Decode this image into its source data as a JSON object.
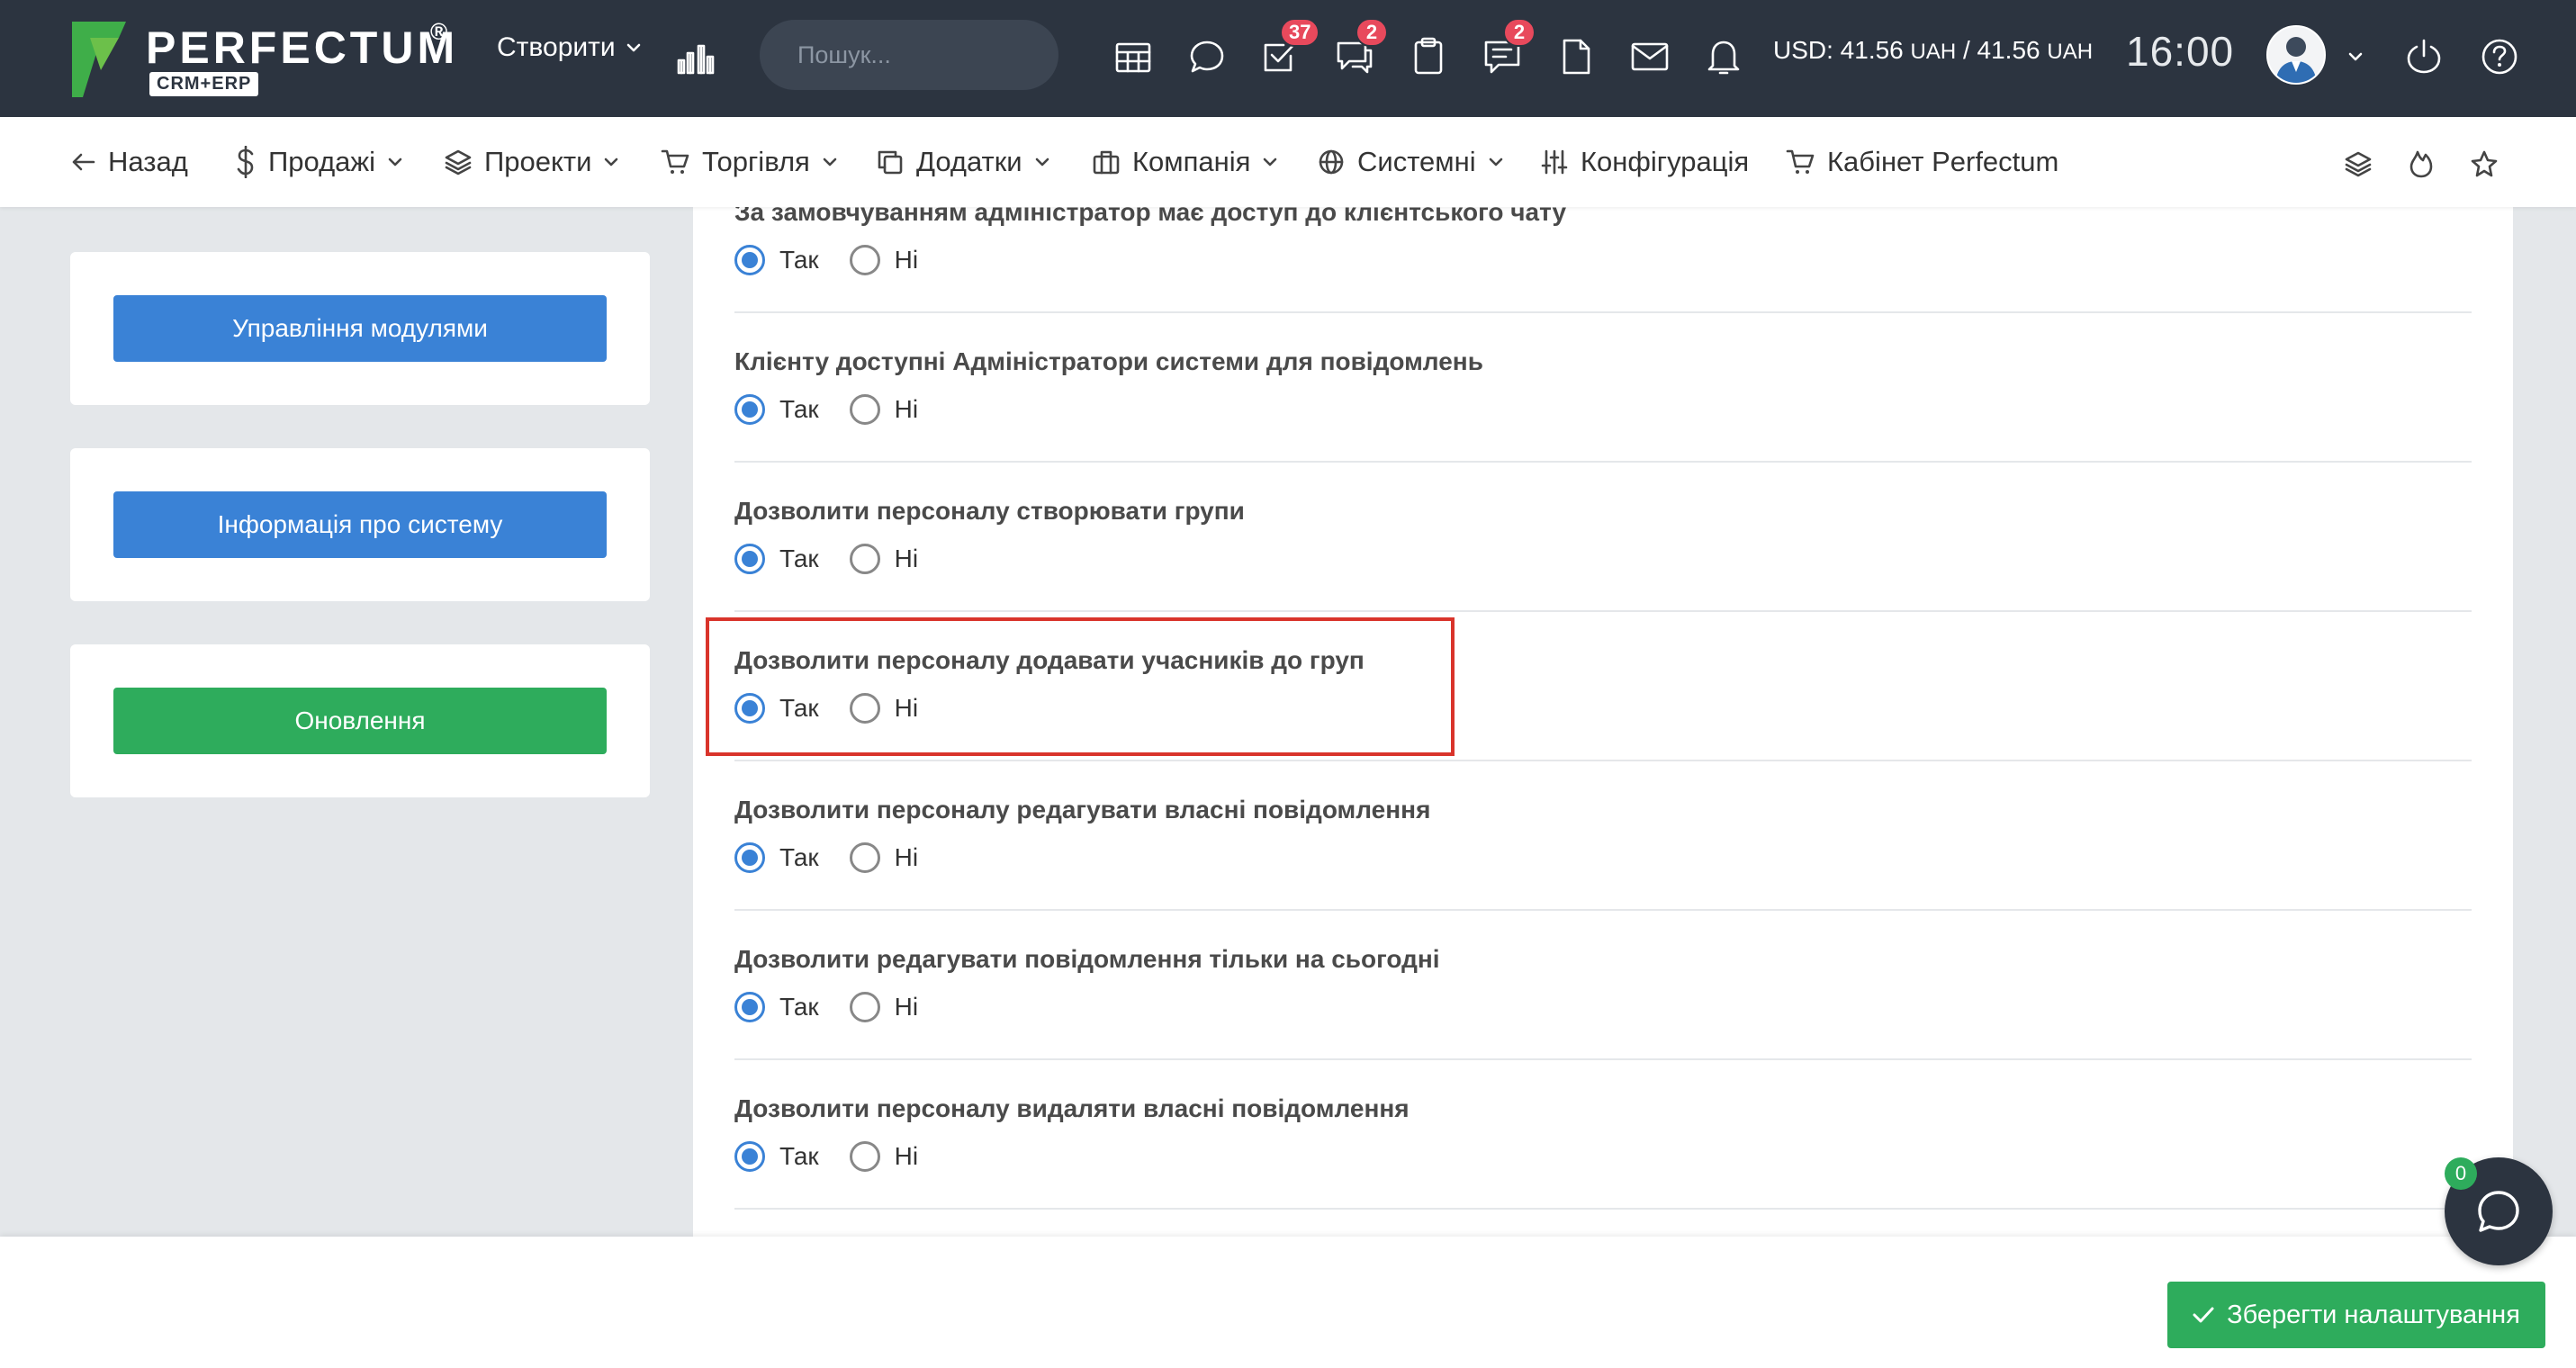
{
  "app": {
    "logo_text": "PERFECTUM",
    "logo_reg": "®",
    "logo_sub": "CRM+ERP"
  },
  "topbar": {
    "create_label": "Створити",
    "search_placeholder": "Пошук...",
    "badges": {
      "tasks": "37",
      "chat": "2",
      "notes": "2"
    },
    "rates": {
      "prefix": "USD: 41.56 ",
      "unit1": "UAH",
      "mid": " / 41.56 ",
      "unit2": "UAH"
    },
    "clock": "16:00"
  },
  "nav": {
    "back": "Назад",
    "sales": "Продажі",
    "projects": "Проекти",
    "trade": "Торгівля",
    "addons": "Додатки",
    "company": "Компанія",
    "system": "Системні",
    "config": "Конфігурація",
    "cabinet": "Кабінет Perfectum"
  },
  "left_panels": {
    "modules_button": "Управління модулями",
    "info_button": "Інформація про систему",
    "update_button": "Оновлення"
  },
  "options": {
    "yes": "Так",
    "no": "Ні"
  },
  "settings": [
    {
      "label": "За замовчуванням адміністратор має доступ до клієнтського чату",
      "value": "yes"
    },
    {
      "label": "Клієнту доступні Адміністратори системи для повідомлень",
      "value": "yes"
    },
    {
      "label": "Дозволити персоналу створювати групи",
      "value": "yes"
    },
    {
      "label": "Дозволити персоналу додавати учасників до груп",
      "value": "yes"
    },
    {
      "label": "Дозволити персоналу редагувати власні повідомлення",
      "value": "yes"
    },
    {
      "label": "Дозволити редагувати повідомлення тільки на сьогодні",
      "value": "yes"
    },
    {
      "label": "Дозволити персоналу видаляти власні повідомлення",
      "value": "yes"
    }
  ],
  "footer": {
    "save_label": "Зберегти налаштування"
  },
  "chat_widget": {
    "count": "0"
  },
  "colors": {
    "accent": "#3a82d6",
    "success": "#2eac5c",
    "badge": "#e8495c",
    "highlight": "#d9342b",
    "topbar": "#2c3440"
  }
}
